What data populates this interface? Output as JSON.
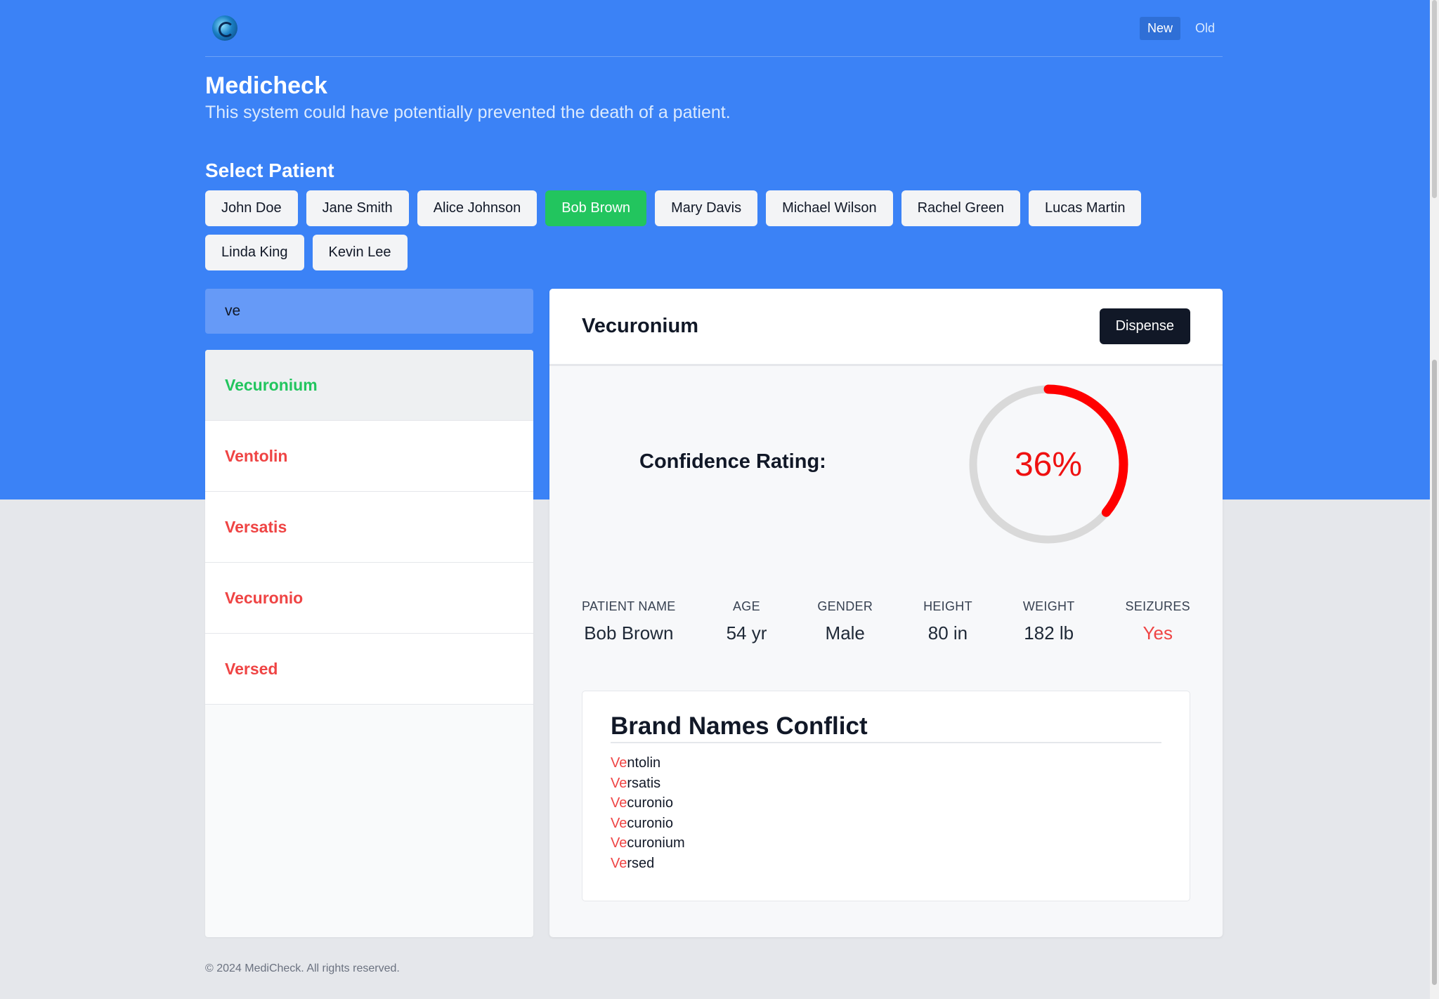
{
  "app": {
    "title": "Medicheck",
    "subtitle": "This system could have potentially prevented the death of a patient."
  },
  "nav": {
    "logo_icon": "globe-logo-icon",
    "versions": [
      {
        "label": "New",
        "active": true
      },
      {
        "label": "Old",
        "active": false
      }
    ]
  },
  "patients": {
    "label": "Select Patient",
    "items": [
      {
        "name": "John Doe",
        "active": false
      },
      {
        "name": "Jane Smith",
        "active": false
      },
      {
        "name": "Alice Johnson",
        "active": false
      },
      {
        "name": "Bob Brown",
        "active": true
      },
      {
        "name": "Mary Davis",
        "active": false
      },
      {
        "name": "Michael Wilson",
        "active": false
      },
      {
        "name": "Rachel Green",
        "active": false
      },
      {
        "name": "Lucas Martin",
        "active": false
      },
      {
        "name": "Linda King",
        "active": false
      },
      {
        "name": "Kevin Lee",
        "active": false
      }
    ]
  },
  "search": {
    "value": "ve"
  },
  "drugs": [
    {
      "name": "Vecuronium",
      "selected": true
    },
    {
      "name": "Ventolin",
      "selected": false
    },
    {
      "name": "Versatis",
      "selected": false
    },
    {
      "name": "Vecuronio",
      "selected": false
    },
    {
      "name": "Versed",
      "selected": false
    }
  ],
  "detail": {
    "drug_name": "Vecuronium",
    "dispense_label": "Dispense",
    "confidence_label": "Confidence Rating:",
    "confidence_value": 36,
    "confidence_text": "36%",
    "gauge_color": "#ff0000",
    "gauge_track_color": "#d9d9d9",
    "stats": [
      {
        "label": "PATIENT NAME",
        "value": "Bob Brown",
        "alert": false
      },
      {
        "label": "AGE",
        "value": "54 yr",
        "alert": false
      },
      {
        "label": "GENDER",
        "value": "Male",
        "alert": false
      },
      {
        "label": "HEIGHT",
        "value": "80 in",
        "alert": false
      },
      {
        "label": "WEIGHT",
        "value": "182 lb",
        "alert": false
      },
      {
        "label": "SEIZURES",
        "value": "Yes",
        "alert": true
      }
    ],
    "conflict": {
      "title": "Brand Names Conflict",
      "items": [
        {
          "prefix": "Ve",
          "rest": "ntolin"
        },
        {
          "prefix": "Ve",
          "rest": "rsatis"
        },
        {
          "prefix": "Ve",
          "rest": "curonio"
        },
        {
          "prefix": "Ve",
          "rest": "curonio"
        },
        {
          "prefix": "Ve",
          "rest": "curonium"
        },
        {
          "prefix": "Ve",
          "rest": "rsed"
        }
      ]
    }
  },
  "footer": {
    "text": "© 2024 MediCheck. All rights reserved."
  },
  "colors": {
    "brand_blue": "#3b82f6",
    "success_green": "#22c55e",
    "danger_red": "#ef4444",
    "dark": "#111827"
  }
}
